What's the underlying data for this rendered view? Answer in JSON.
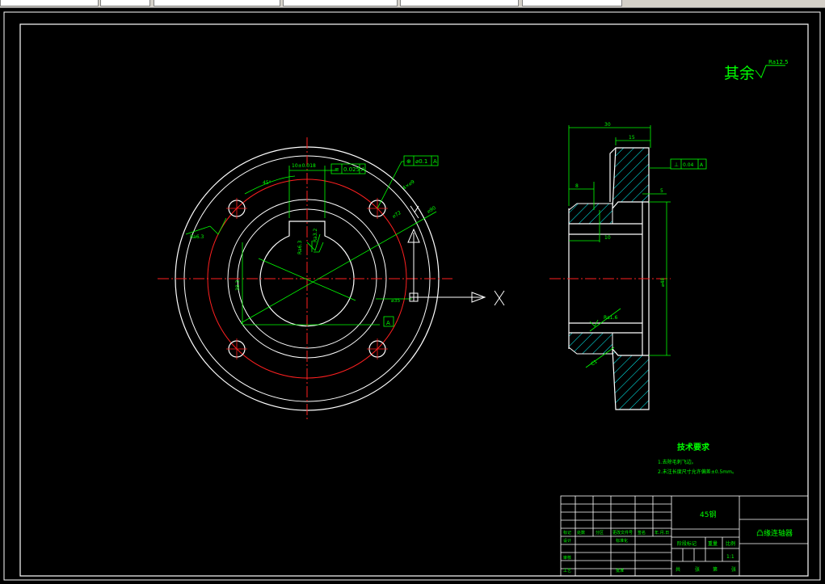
{
  "toolbar": {
    "cells": [
      "",
      "",
      "",
      "",
      "",
      ""
    ]
  },
  "drawing": {
    "surface_note": {
      "text": "其余",
      "roughness": "Ra12.5"
    },
    "front_view": {
      "dim_keyway_width": "10±0.018",
      "dim_symmetry": "0.025",
      "dim_symmetry_datum": "A",
      "dim_position": "⌀0.1",
      "dim_position_datum": "A",
      "dim_angle": "45°",
      "dim_hole_dia": "4×⌀9",
      "dim_pcd": "⌀72",
      "dim_outer": "⌀90",
      "dim_bore": "⌀35",
      "dim_keyway_depth": "38.3",
      "rough_left": "Ra6.3",
      "rough_key1": "Ra6.3",
      "rough_key2": "Ra3.2",
      "rough_bore": "Ra0.8",
      "datum_label": "A",
      "axis_label": "X"
    },
    "side_view": {
      "dim_total": "30",
      "dim_flange": "15",
      "dim_small": "8",
      "dim_step": "5",
      "dim_hub": "10",
      "dim_dia": "⌀48",
      "perp_value": "0.04",
      "perp_datum": "A",
      "rough_bore": "Ra1.6",
      "chamfer": "C1"
    },
    "tech_notes": {
      "title": "技术要求",
      "items": [
        "1.去除毛刺飞边。",
        "2.未注长度尺寸允许偏差±0.5mm。"
      ]
    },
    "title_block": {
      "material": "45钢",
      "part_name": "凸缘连轴器",
      "ratio_label": "比例",
      "ratio_value": "1:1",
      "weight_label": "重量",
      "stage_label": "阶段标记",
      "header_cells": [
        "标记",
        "处数",
        "分区",
        "更改文件号",
        "签名",
        "年.月.日"
      ],
      "design_label": "设计",
      "std_label": "标准化",
      "review_label": "审核",
      "process_label": "工艺",
      "approve_label": "批准",
      "sheet_text": [
        "共",
        "张",
        "第",
        "张"
      ]
    }
  }
}
